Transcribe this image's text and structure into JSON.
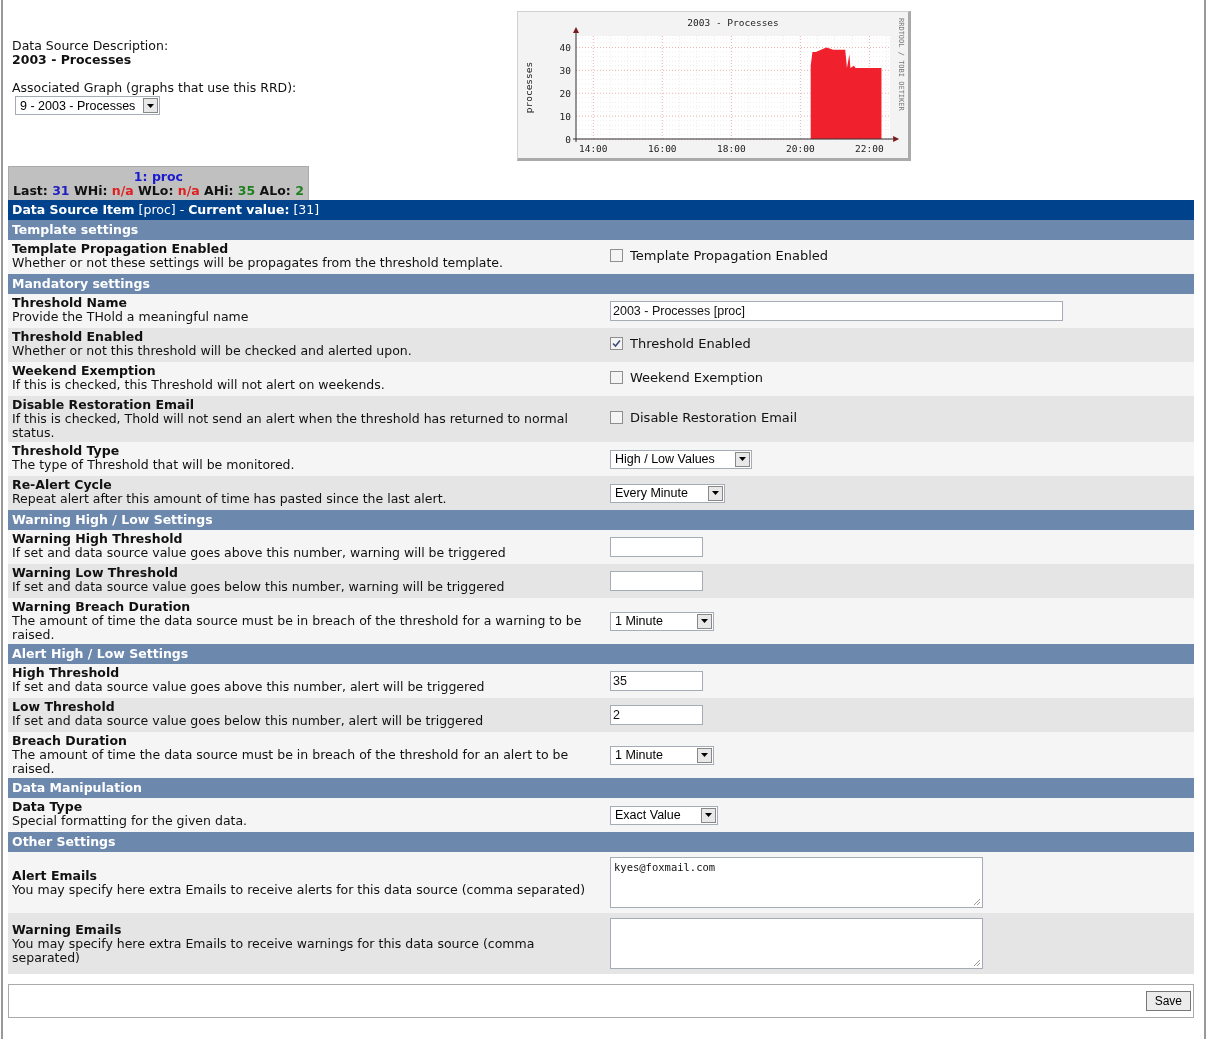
{
  "description_label": "Data Source Description:",
  "description_value": "2003 - Processes",
  "graph_label": "Associated Graph (graphs that use this RRD):",
  "graph_select": {
    "value": "9 - 2003 - Processes"
  },
  "graph": {
    "credit": "RRDTOOL / TOBI OETIKER",
    "chart_data": {
      "type": "area",
      "title": "2003 - Processes",
      "ylabel": "processes",
      "x": [
        20.3,
        20.35,
        20.45,
        20.6,
        20.75,
        20.85,
        20.95,
        21.3,
        21.35,
        21.42,
        21.45,
        21.55,
        21.6,
        21.7,
        22.0,
        22.35
      ],
      "grid": true,
      "series": [
        {
          "color": "#f0202c",
          "values": [
            32,
            38,
            38,
            39,
            40,
            39.5,
            39,
            39,
            31,
            37,
            31,
            32,
            31,
            31,
            31,
            31
          ]
        }
      ],
      "xlim": [
        13.5,
        22.6
      ],
      "ylim": [
        0,
        45
      ],
      "xticks": [
        {
          "value": 14,
          "label": "14:00"
        },
        {
          "value": 16,
          "label": "16:00"
        },
        {
          "value": 18,
          "label": "18:00"
        },
        {
          "value": 20,
          "label": "20:00"
        },
        {
          "value": 22,
          "label": "22:00"
        }
      ],
      "yticks": [
        0,
        10,
        20,
        30,
        40
      ]
    }
  },
  "tab": {
    "title": "1: proc",
    "stats": [
      {
        "label": "Last:",
        "value": "31",
        "color": "#2020c0"
      },
      {
        "label": "WHi:",
        "value": "n/a",
        "color": "#e02020"
      },
      {
        "label": "WLo:",
        "value": "n/a",
        "color": "#e02020"
      },
      {
        "label": "AHi:",
        "value": "35",
        "color": "#208020"
      },
      {
        "label": "ALo:",
        "value": "2",
        "color": "#208020"
      }
    ]
  },
  "header": "**Data Source Item** [proc] - **Current value:** [31]",
  "sections": [
    {
      "title": "Template settings",
      "rows": [
        {
          "label": "Template Propagation Enabled",
          "description": "Whether or not these settings will be propagates from the threshold template.",
          "kind": "checkbox",
          "text": "Template Propagation Enabled",
          "checked": false
        }
      ]
    },
    {
      "title": "Mandatory settings",
      "rows": [
        {
          "label": "Threshold Name",
          "description": "Provide the THold a meaningful name",
          "kind": "text",
          "value": "2003 - Processes [proc]"
        },
        {
          "label": "Threshold Enabled",
          "description": "Whether or not this threshold will be checked and alerted upon.",
          "kind": "checkbox",
          "text": "Threshold Enabled",
          "checked": true
        },
        {
          "label": "Weekend Exemption",
          "description": "If this is checked, this Threshold will not alert on weekends.",
          "kind": "checkbox",
          "text": "Weekend Exemption",
          "checked": false
        },
        {
          "label": "Disable Restoration Email",
          "description": "If this is checked, Thold will not send an alert when the threshold has returned to normal status.",
          "kind": "checkbox",
          "text": "Disable Restoration Email",
          "checked": false
        },
        {
          "label": "Threshold Type",
          "description": "The type of Threshold that will be monitored.",
          "kind": "select",
          "value": "High / Low Values"
        },
        {
          "label": "Re-Alert Cycle",
          "description": "Repeat alert after this amount of time has pasted since the last alert.",
          "kind": "select",
          "value": "Every Minute"
        }
      ]
    },
    {
      "title": "Warning High / Low Settings",
      "rows": [
        {
          "label": "Warning High Threshold",
          "description": "If set and data source value goes above this number, warning will be triggered",
          "kind": "short"
        },
        {
          "label": "Warning Low Threshold",
          "description": "If set and data source value goes below this number, warning will be triggered",
          "kind": "short"
        },
        {
          "label": "Warning Breach Duration",
          "description": "The amount of time the data source must be in breach of the threshold for a warning to be raised.",
          "kind": "select",
          "value": "1 Minute"
        }
      ]
    },
    {
      "title": "Alert High / Low Settings",
      "rows": [
        {
          "label": "High Threshold",
          "description": "If set and data source value goes above this number, alert will be triggered",
          "kind": "short",
          "value": "35"
        },
        {
          "label": "Low Threshold",
          "description": "If set and data source value goes below this number, alert will be triggered",
          "kind": "short",
          "value": "2"
        },
        {
          "label": "Breach Duration",
          "description": "The amount of time the data source must be in breach of the threshold for an alert to be raised.",
          "kind": "select",
          "value": "1 Minute"
        }
      ]
    },
    {
      "title": "Data Manipulation",
      "rows": [
        {
          "label": "Data Type",
          "description": "Special formatting for the given data.",
          "kind": "select",
          "value": "Exact Value"
        }
      ]
    },
    {
      "title": "Other Settings",
      "rows": [
        {
          "label": "Alert Emails",
          "description": "You may specify here extra Emails to receive alerts for this data source (comma separated)",
          "kind": "textarea",
          "value": "kyes@foxmail.com"
        },
        {
          "label": "Warning Emails",
          "description": "You may specify here extra Emails to receive warnings for this data source (comma separated)",
          "kind": "textarea"
        }
      ]
    }
  ],
  "save_button": "Save"
}
